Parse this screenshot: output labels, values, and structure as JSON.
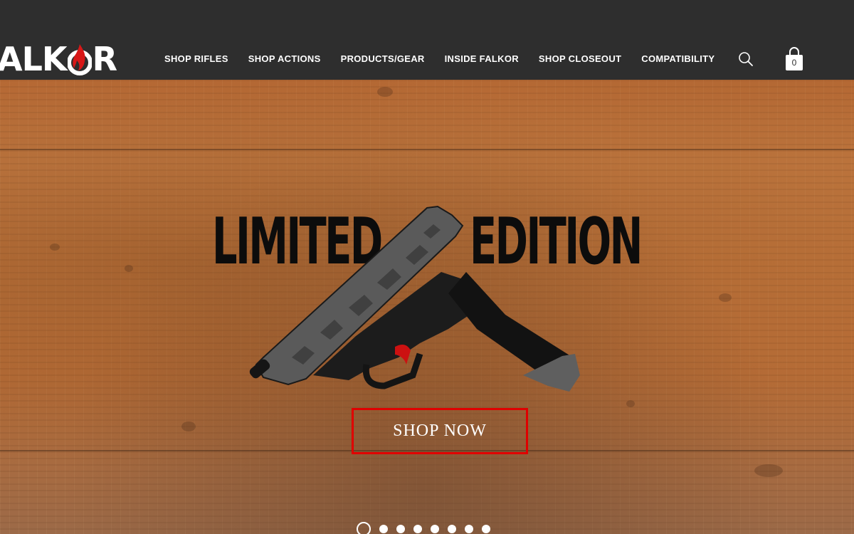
{
  "brand": {
    "logo_text_left": "ALK",
    "logo_text_right": "R",
    "accent_color": "#e00000"
  },
  "nav": {
    "items": [
      {
        "label": "SHOP RIFLES"
      },
      {
        "label": "SHOP ACTIONS"
      },
      {
        "label": "PRODUCTS/GEAR"
      },
      {
        "label": "INSIDE FALKOR"
      },
      {
        "label": "SHOP CLOSEOUT"
      },
      {
        "label": "COMPATIBILITY"
      }
    ],
    "search_icon": "search-icon",
    "cart_icon": "shopping-bag-icon",
    "cart_count": "0"
  },
  "hero": {
    "title_left": "LIMITED",
    "title_right": "EDITION",
    "cta_label": "SHOP NOW",
    "slides_total": 8,
    "active_slide": 1
  }
}
